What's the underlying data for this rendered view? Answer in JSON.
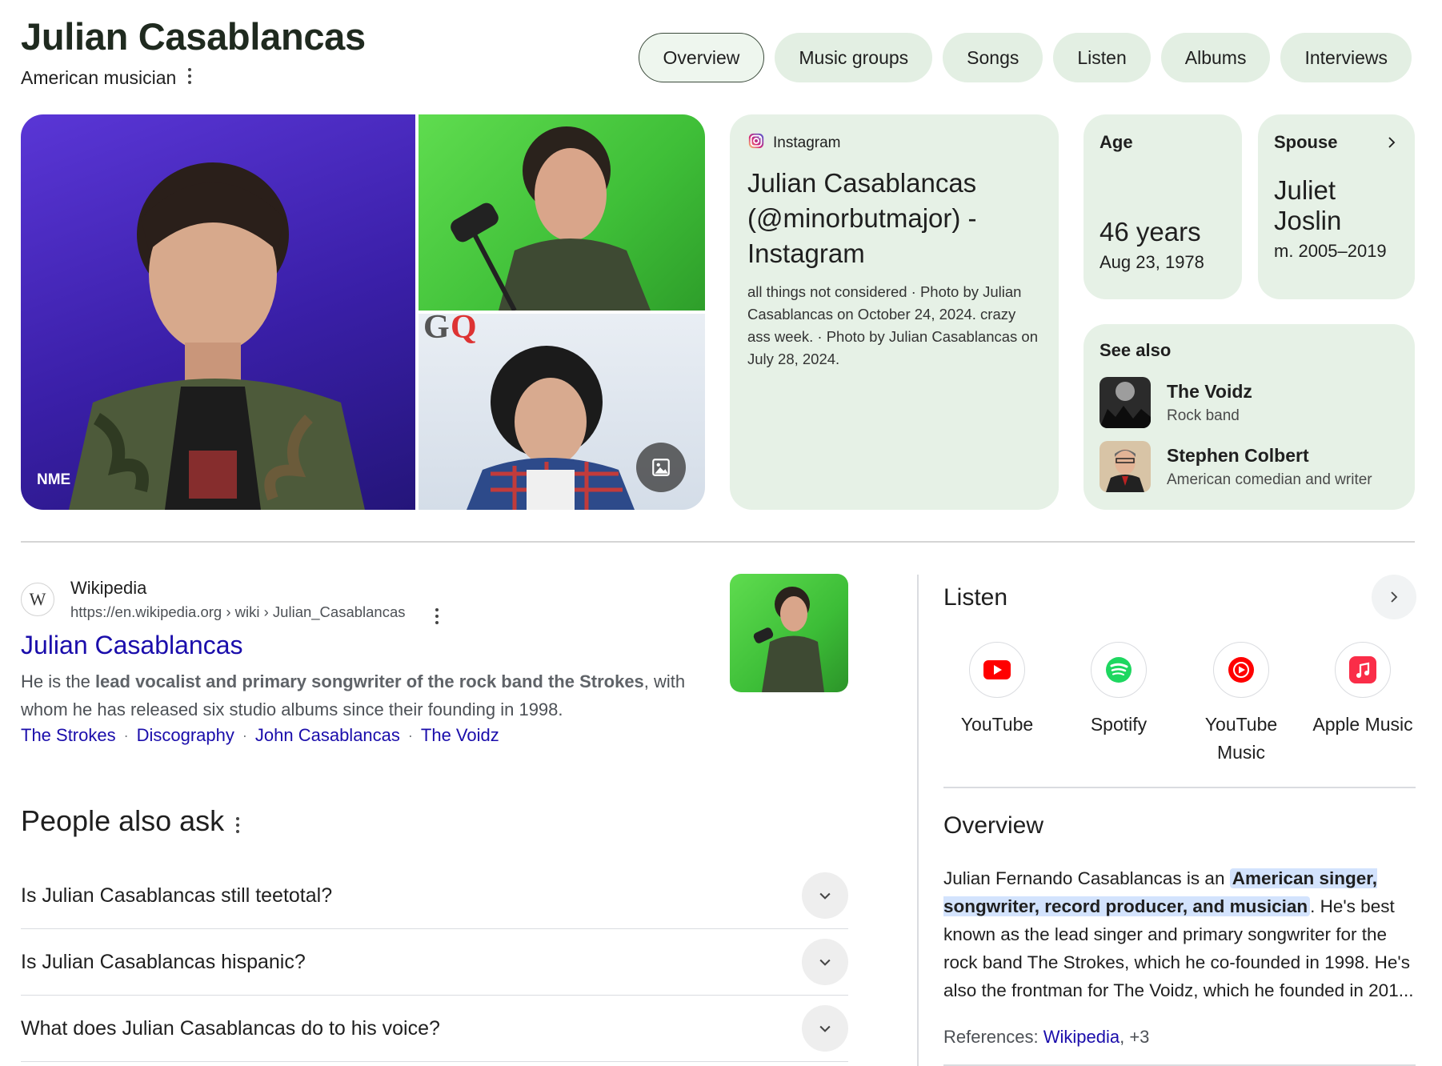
{
  "header": {
    "title": "Julian Casablancas",
    "subtitle": "American musician"
  },
  "tabs": [
    {
      "label": "Overview",
      "active": true
    },
    {
      "label": "Music groups"
    },
    {
      "label": "Songs"
    },
    {
      "label": "Listen"
    },
    {
      "label": "Albums"
    },
    {
      "label": "Interviews"
    }
  ],
  "images": {
    "main_credit": "NME",
    "gq_logo": "GQ"
  },
  "instagram": {
    "source": "Instagram",
    "title": "Julian Casablancas (@minorbutmajor) - Instagram",
    "description": "all things not considered · Photo by Julian Casablancas on October 24, 2024. crazy ass week. · Photo by Julian Casablancas on July 28, 2024."
  },
  "facts": {
    "age": {
      "label": "Age",
      "value": "46 years",
      "detail": "Aug 23, 1978"
    },
    "spouse": {
      "label": "Spouse",
      "value": "Juliet Joslin",
      "detail": "m. 2005–2019"
    }
  },
  "see_also": {
    "title": "See also",
    "items": [
      {
        "name": "The Voidz",
        "desc": "Rock band"
      },
      {
        "name": "Stephen Colbert",
        "desc": "American comedian and writer"
      }
    ]
  },
  "wiki": {
    "favicon": "W",
    "site": "Wikipedia",
    "url": "https://en.wikipedia.org › wiki › Julian_Casablancas",
    "title": "Julian Casablancas",
    "snippet_pre": "He is the ",
    "snippet_bold": "lead vocalist and primary songwriter of the rock band the Strokes",
    "snippet_post": ", with whom he has released six studio albums since their founding in 1998.",
    "links": [
      "The Strokes",
      "Discography",
      "John Casablancas",
      "The Voidz"
    ],
    "separator": "·"
  },
  "paa": {
    "title": "People also ask",
    "questions": [
      "Is Julian Casablancas still teetotal?",
      "Is Julian Casablancas hispanic?",
      "What does Julian Casablancas do to his voice?"
    ]
  },
  "listen": {
    "title": "Listen",
    "services": [
      {
        "label": "YouTube",
        "icon": "youtube-icon",
        "color": "#ff0000"
      },
      {
        "label": "Spotify",
        "icon": "spotify-icon",
        "color": "#1ed760"
      },
      {
        "label": "YouTube Music",
        "icon": "youtube-music-icon",
        "color": "#ff0000"
      },
      {
        "label": "Apple Music",
        "icon": "apple-music-icon",
        "color": "#fa2d48"
      }
    ]
  },
  "overview": {
    "title": "Overview",
    "text_pre": "Julian Fernando Casablancas is an ",
    "text_highlight": "American singer, songwriter, record producer, and musician",
    "text_post": ". He's best known as the lead singer and primary songwriter for the rock band The Strokes, which he co-founded in 1998. He's also the frontman for The Voidz, which he founded in 201...",
    "refs_label": "References: ",
    "refs_link": "Wikipedia",
    "refs_more": ", +3"
  },
  "colors": {
    "card_bg": "#e6f1e6",
    "tab_bg": "#e3efe3",
    "link": "#1a0dab",
    "highlight": "#d3e3fd"
  }
}
